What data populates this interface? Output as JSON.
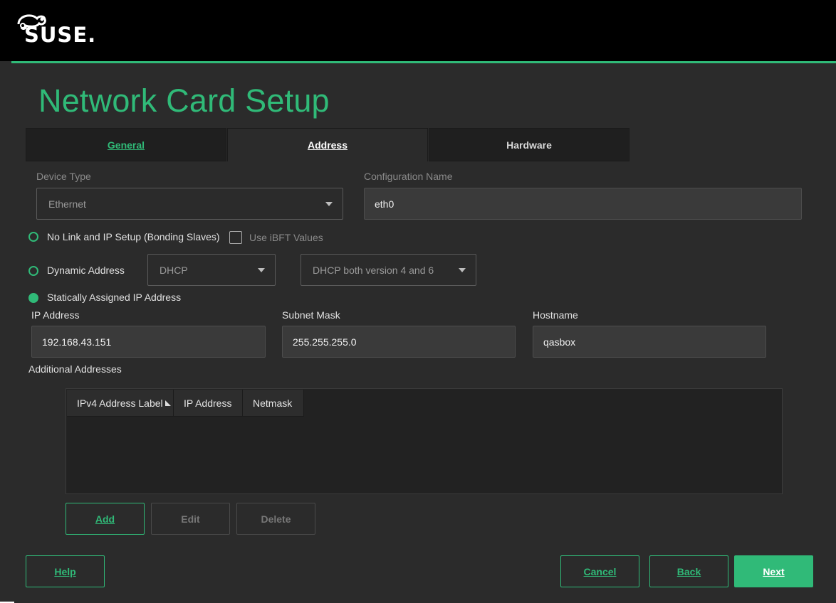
{
  "brand": {
    "logo_text": "SUSE.",
    "accent_color": "#30ba78"
  },
  "page": {
    "title": "Network Card Setup"
  },
  "tabs": [
    {
      "label": "General",
      "active": false
    },
    {
      "label": "Address",
      "active": true
    },
    {
      "label": "Hardware",
      "active": false
    }
  ],
  "device_type": {
    "label": "Device Type",
    "value": "Ethernet"
  },
  "configuration_name": {
    "label": "Configuration Name",
    "value": "eth0"
  },
  "ip_setup": {
    "no_link": {
      "label": "No Link and IP Setup (Bonding Slaves)",
      "selected": false
    },
    "use_ibft": {
      "label": "Use iBFT Values",
      "checked": false
    },
    "dynamic": {
      "label": "Dynamic Address",
      "selected": false,
      "method": "DHCP",
      "version": "DHCP both version 4 and 6"
    },
    "static": {
      "label": "Statically Assigned IP Address",
      "selected": true
    }
  },
  "ip_address": {
    "label": "IP Address",
    "value": "192.168.43.151"
  },
  "subnet_mask": {
    "label": "Subnet Mask",
    "value": "255.255.255.0"
  },
  "hostname": {
    "label": "Hostname",
    "value": "qasbox"
  },
  "additional": {
    "label": "Additional Addresses",
    "columns": [
      "IPv4 Address Label",
      "IP Address",
      "Netmask"
    ],
    "rows": []
  },
  "table_buttons": {
    "add": "Add",
    "edit": "Edit",
    "delete": "Delete"
  },
  "footer": {
    "help": "Help",
    "cancel": "Cancel",
    "back": "Back",
    "next": "Next"
  }
}
